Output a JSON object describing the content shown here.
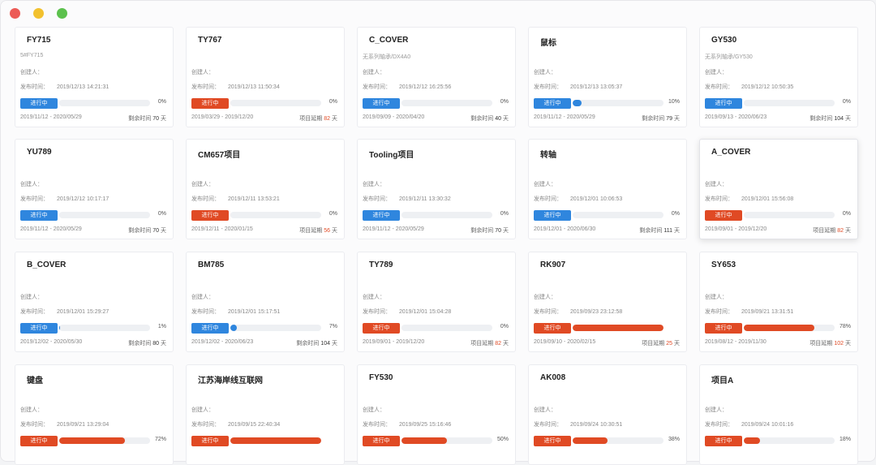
{
  "window": {
    "controls": [
      "close",
      "minimize",
      "maximize"
    ]
  },
  "labels": {
    "creator": "创建人：",
    "publish_time": "发布时间：",
    "remaining": "剩余时间",
    "delayed": "项目延期",
    "days": "天"
  },
  "projects": [
    {
      "title": "FY715",
      "sub": "5#FY715",
      "time": "2019/12/13 14:21:31",
      "status": "进行中",
      "status_color": "blue",
      "progress": 0,
      "pct": "0%",
      "range": "2019/11/12 - 2020/05/29",
      "remain_type": "remaining",
      "remain_days": "70"
    },
    {
      "title": "TY767",
      "sub": "",
      "time": "2019/12/13 11:50:34",
      "status": "进行中",
      "status_color": "red",
      "progress": 0,
      "pct": "0%",
      "range": "2019/03/29 - 2019/12/20",
      "remain_type": "delayed",
      "remain_days": "82"
    },
    {
      "title": "C_COVER",
      "sub": "无系列轴承/DX4A0",
      "time": "2019/12/12 16:25:56",
      "status": "进行中",
      "status_color": "blue",
      "progress": 0,
      "pct": "0%",
      "range": "2019/09/09 - 2020/04/20",
      "remain_type": "remaining",
      "remain_days": "40"
    },
    {
      "title": "鼠标",
      "sub": "",
      "time": "2019/12/13 13:05:37",
      "status": "进行中",
      "status_color": "blue",
      "progress": 10,
      "pct": "10%",
      "range": "2019/11/12 - 2020/05/29",
      "remain_type": "remaining",
      "remain_days": "79"
    },
    {
      "title": "GY530",
      "sub": "无系列轴承/GY530",
      "time": "2019/12/12 10:50:35",
      "status": "进行中",
      "status_color": "blue",
      "progress": 0,
      "pct": "0%",
      "range": "2019/09/13 - 2020/06/23",
      "remain_type": "remaining",
      "remain_days": "104"
    },
    {
      "title": "YU789",
      "sub": "",
      "time": "2019/12/12 10:17:17",
      "status": "进行中",
      "status_color": "blue",
      "progress": 0,
      "pct": "0%",
      "range": "2019/11/12 - 2020/05/29",
      "remain_type": "remaining",
      "remain_days": "70"
    },
    {
      "title": "CM657项目",
      "sub": "",
      "time": "2019/12/11 13:53:21",
      "status": "进行中",
      "status_color": "red",
      "progress": 0,
      "pct": "0%",
      "range": "2019/12/11 - 2020/01/15",
      "remain_type": "delayed",
      "remain_days": "56"
    },
    {
      "title": "Tooling项目",
      "sub": "",
      "time": "2019/12/11 13:30:32",
      "status": "进行中",
      "status_color": "blue",
      "progress": 0,
      "pct": "0%",
      "range": "2019/11/12 - 2020/05/29",
      "remain_type": "remaining",
      "remain_days": "70"
    },
    {
      "title": "转轴",
      "sub": "",
      "time": "2019/12/01 10:06:53",
      "status": "进行中",
      "status_color": "blue",
      "progress": 0,
      "pct": "0%",
      "range": "2019/12/01 - 2020/06/30",
      "remain_type": "remaining",
      "remain_days": "111"
    },
    {
      "title": "A_COVER",
      "sub": "",
      "time": "2019/12/01 15:56:08",
      "status": "进行中",
      "status_color": "red",
      "progress": 0,
      "pct": "0%",
      "range": "2019/09/01 - 2019/12/20",
      "remain_type": "delayed",
      "remain_days": "82",
      "highlight": true
    },
    {
      "title": "B_COVER",
      "sub": "",
      "time": "2019/12/01 15:29:27",
      "status": "进行中",
      "status_color": "blue",
      "progress": 1,
      "pct": "1%",
      "range": "2019/12/02 - 2020/05/30",
      "remain_type": "remaining",
      "remain_days": "80"
    },
    {
      "title": "BM785",
      "sub": "",
      "time": "2019/12/01 15:17:51",
      "status": "进行中",
      "status_color": "blue",
      "progress": 7,
      "pct": "7%",
      "range": "2019/12/02 - 2020/06/23",
      "remain_type": "remaining",
      "remain_days": "104"
    },
    {
      "title": "TY789",
      "sub": "",
      "time": "2019/12/01 15:04:28",
      "status": "进行中",
      "status_color": "red",
      "progress": 0,
      "pct": "0%",
      "range": "2019/09/01 - 2019/12/20",
      "remain_type": "delayed",
      "remain_days": "82"
    },
    {
      "title": "RK907",
      "sub": "",
      "time": "2019/09/23 23:12:58",
      "status": "进行中",
      "status_color": "red",
      "progress": 100,
      "pct": "",
      "range": "2019/09/10 - 2020/02/15",
      "remain_type": "delayed",
      "remain_days": "25"
    },
    {
      "title": "SY653",
      "sub": "",
      "time": "2019/09/21 13:31:51",
      "status": "进行中",
      "status_color": "red",
      "progress": 78,
      "pct": "78%",
      "range": "2019/08/12 - 2019/11/30",
      "remain_type": "delayed",
      "remain_days": "102"
    },
    {
      "title": "键盘",
      "sub": "",
      "time": "2019/09/21 13:29:04",
      "status": "进行中",
      "status_color": "red",
      "progress": 72,
      "pct": "72%",
      "range": "",
      "remain_type": "",
      "remain_days": ""
    },
    {
      "title": "江苏海岸线互联网",
      "sub": "",
      "time": "2019/09/15 22:40:34",
      "status": "进行中",
      "status_color": "red",
      "progress": 100,
      "pct": "",
      "range": "",
      "remain_type": "",
      "remain_days": ""
    },
    {
      "title": "FY530",
      "sub": "",
      "time": "2019/09/25 15:16:46",
      "status": "进行中",
      "status_color": "red",
      "progress": 50,
      "pct": "50%",
      "range": "",
      "remain_type": "",
      "remain_days": ""
    },
    {
      "title": "AK008",
      "sub": "",
      "time": "2019/09/24 10:30:51",
      "status": "进行中",
      "status_color": "red",
      "progress": 38,
      "pct": "38%",
      "range": "",
      "remain_type": "",
      "remain_days": ""
    },
    {
      "title": "项目A",
      "sub": "",
      "time": "2019/09/24 10:01:16",
      "status": "进行中",
      "status_color": "red",
      "progress": 18,
      "pct": "18%",
      "range": "",
      "remain_type": "",
      "remain_days": ""
    }
  ]
}
